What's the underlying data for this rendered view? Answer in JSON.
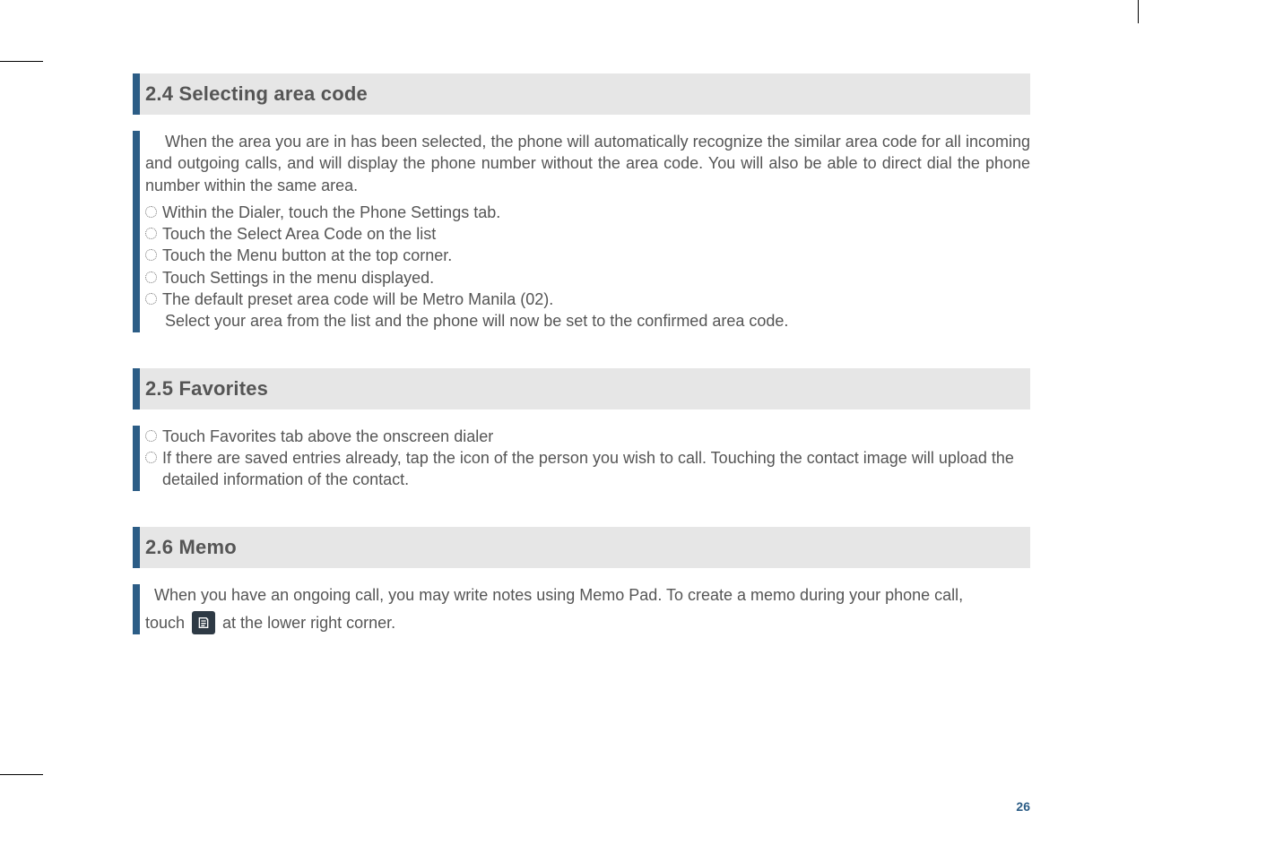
{
  "section1": {
    "heading": "2.4 Selecting area code",
    "intro": "When the area you are in has been selected, the phone will automatically recognize the similar area code for all incoming and outgoing calls, and will display the phone number without the area code. You will also be able to direct dial the phone number within the same area.",
    "bullets": [
      "Within the Dialer, touch the Phone Settings tab.",
      "Touch the Select Area Code on the list",
      "Touch the Menu button at the top corner.",
      "Touch Settings in the menu displayed.",
      "The default preset area code will be Metro Manila (02)."
    ],
    "closing": "Select your area from the list and the phone will now be set to the confirmed area code."
  },
  "section2": {
    "heading": "2.5 Favorites",
    "bullets": [
      "Touch Favorites tab above the onscreen dialer",
      "If there are saved entries already, tap the icon of the person you wish to call. Touching the contact image will upload the detailed information of the contact."
    ]
  },
  "section3": {
    "heading": "2.6 Memo",
    "line1": "When you have an ongoing call, you may write notes using Memo Pad. To create a memo during your phone call,",
    "line2_before": "touch",
    "line2_after": "at the lower right corner."
  },
  "pageNumber": "26"
}
